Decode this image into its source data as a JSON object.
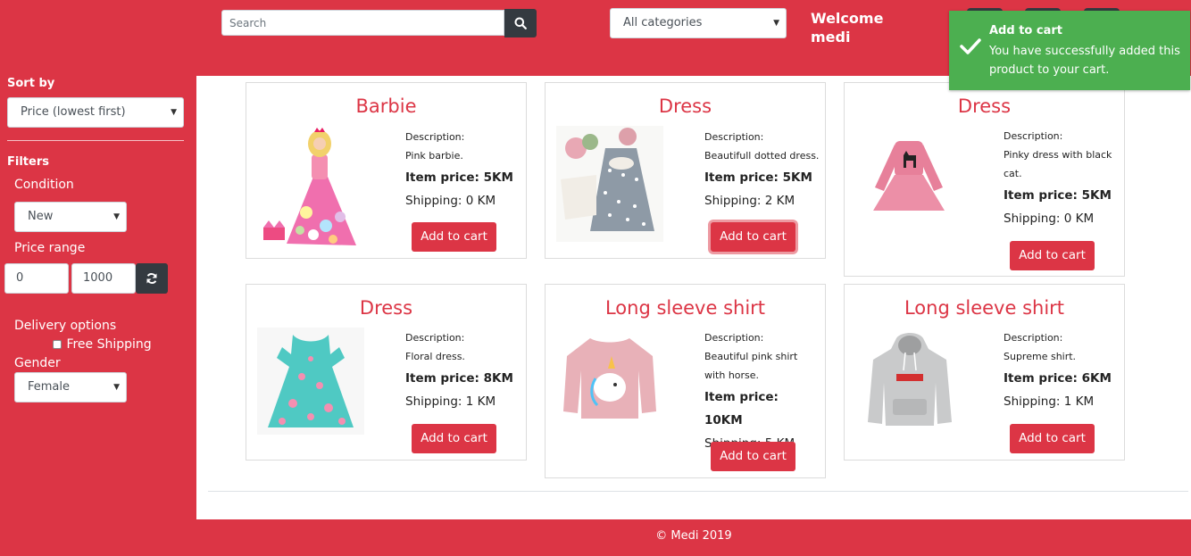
{
  "header": {
    "search_placeholder": "Search",
    "category_select": "All categories",
    "welcome": "Welcome medi"
  },
  "sidebar": {
    "sort_by_label": "Sort by",
    "sort_value": "Price (lowest first)",
    "filters_label": "Filters",
    "condition_label": "Condition",
    "condition_value": "New",
    "price_range_label": "Price range",
    "price_min": "0",
    "price_max": "1000",
    "delivery_label": "Delivery options",
    "free_shipping_label": "Free Shipping",
    "gender_label": "Gender",
    "gender_value": "Female"
  },
  "products": [
    {
      "title": "Barbie",
      "desc_label": "Description:",
      "description": "Pink barbie.",
      "price": "Item price: 5KM",
      "shipping": "Shipping: 0 KM",
      "button": "Add to cart"
    },
    {
      "title": "Dress",
      "desc_label": "Description:",
      "description": "Beautifull dotted dress.",
      "price": "Item price: 5KM",
      "shipping": "Shipping: 2 KM",
      "button": "Add to cart"
    },
    {
      "title": "Dress",
      "desc_label": "Description:",
      "description": "Pinky dress with black cat.",
      "price": "Item price: 5KM",
      "shipping": "Shipping: 0 KM",
      "button": "Add to cart"
    },
    {
      "title": "Dress",
      "desc_label": "Description:",
      "description": "Floral dress.",
      "price": "Item price: 8KM",
      "shipping": "Shipping: 1 KM",
      "button": "Add to cart"
    },
    {
      "title": "Long sleeve shirt",
      "desc_label": "Description:",
      "description": "Beautiful pink shirt with horse.",
      "price": "Item price: 10KM",
      "shipping": "Shipping: 5 KM",
      "button": "Add to cart"
    },
    {
      "title": "Long sleeve shirt",
      "desc_label": "Description:",
      "description": "Supreme shirt.",
      "price": "Item price: 6KM",
      "shipping": "Shipping: 1 KM",
      "button": "Add to cart"
    }
  ],
  "toast": {
    "title": "Add to cart",
    "message": "You have successfully added this product to your cart."
  },
  "footer": {
    "text": "© Medi 2019"
  },
  "colors": {
    "brand": "#dc3545",
    "dark": "#343a40",
    "toast": "#4caf50"
  },
  "icons": [
    "search-icon",
    "refresh-icon",
    "check-icon",
    "chevron-down-icon"
  ]
}
